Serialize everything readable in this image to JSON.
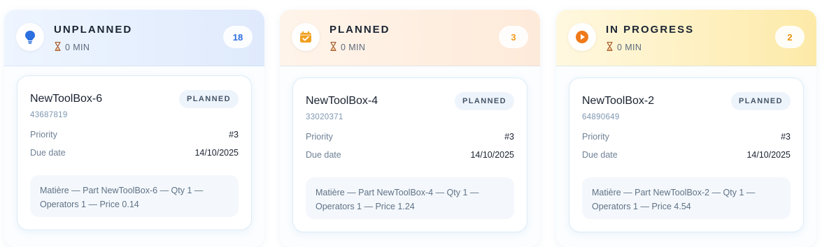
{
  "columns": [
    {
      "title": "UNPLANNED",
      "duration": "0 MIN",
      "count": "18",
      "icon": "lightbulb-icon",
      "accent": "#2b6fe0",
      "card": {
        "title": "NewToolBox-6",
        "id": "43687819",
        "status": "PLANNED",
        "priority_label": "Priority",
        "priority_value": "#3",
        "due_label": "Due date",
        "due_value": "14/10/2025",
        "desc_line1": "Matière — Part NewToolBox-6 — Qty 1 —",
        "desc_line2": "Operators 1 — Price 0.14"
      }
    },
    {
      "title": "PLANNED",
      "duration": "0 MIN",
      "count": "3",
      "icon": "calendar-check-icon",
      "accent": "#f09a1a",
      "card": {
        "title": "NewToolBox-4",
        "id": "33020371",
        "status": "PLANNED",
        "priority_label": "Priority",
        "priority_value": "#3",
        "due_label": "Due date",
        "due_value": "14/10/2025",
        "desc_line1": "Matière — Part NewToolBox-4 — Qty 1 —",
        "desc_line2": "Operators 1 — Price 1.24"
      }
    },
    {
      "title": "IN PROGRESS",
      "duration": "0 MIN",
      "count": "2",
      "icon": "play-circle-icon",
      "accent": "#f07a1a",
      "card": {
        "title": "NewToolBox-2",
        "id": "64890649",
        "status": "PLANNED",
        "priority_label": "Priority",
        "priority_value": "#3",
        "due_label": "Due date",
        "due_value": "14/10/2025",
        "desc_line1": "Matière — Part NewToolBox-2 — Qty 1 —",
        "desc_line2": "Operators 1 — Price 4.54"
      }
    }
  ]
}
